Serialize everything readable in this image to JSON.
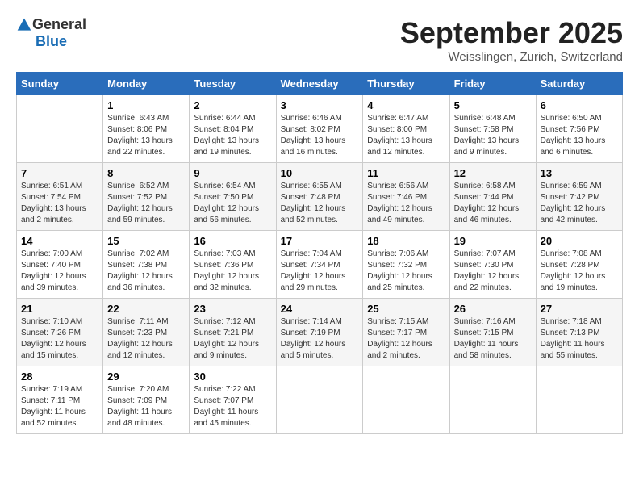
{
  "header": {
    "logo_general": "General",
    "logo_blue": "Blue",
    "month": "September 2025",
    "location": "Weisslingen, Zurich, Switzerland"
  },
  "days_of_week": [
    "Sunday",
    "Monday",
    "Tuesday",
    "Wednesday",
    "Thursday",
    "Friday",
    "Saturday"
  ],
  "weeks": [
    [
      {
        "day": "",
        "sunrise": "",
        "sunset": "",
        "daylight": ""
      },
      {
        "day": "1",
        "sunrise": "Sunrise: 6:43 AM",
        "sunset": "Sunset: 8:06 PM",
        "daylight": "Daylight: 13 hours and 22 minutes."
      },
      {
        "day": "2",
        "sunrise": "Sunrise: 6:44 AM",
        "sunset": "Sunset: 8:04 PM",
        "daylight": "Daylight: 13 hours and 19 minutes."
      },
      {
        "day": "3",
        "sunrise": "Sunrise: 6:46 AM",
        "sunset": "Sunset: 8:02 PM",
        "daylight": "Daylight: 13 hours and 16 minutes."
      },
      {
        "day": "4",
        "sunrise": "Sunrise: 6:47 AM",
        "sunset": "Sunset: 8:00 PM",
        "daylight": "Daylight: 13 hours and 12 minutes."
      },
      {
        "day": "5",
        "sunrise": "Sunrise: 6:48 AM",
        "sunset": "Sunset: 7:58 PM",
        "daylight": "Daylight: 13 hours and 9 minutes."
      },
      {
        "day": "6",
        "sunrise": "Sunrise: 6:50 AM",
        "sunset": "Sunset: 7:56 PM",
        "daylight": "Daylight: 13 hours and 6 minutes."
      }
    ],
    [
      {
        "day": "7",
        "sunrise": "Sunrise: 6:51 AM",
        "sunset": "Sunset: 7:54 PM",
        "daylight": "Daylight: 13 hours and 2 minutes."
      },
      {
        "day": "8",
        "sunrise": "Sunrise: 6:52 AM",
        "sunset": "Sunset: 7:52 PM",
        "daylight": "Daylight: 12 hours and 59 minutes."
      },
      {
        "day": "9",
        "sunrise": "Sunrise: 6:54 AM",
        "sunset": "Sunset: 7:50 PM",
        "daylight": "Daylight: 12 hours and 56 minutes."
      },
      {
        "day": "10",
        "sunrise": "Sunrise: 6:55 AM",
        "sunset": "Sunset: 7:48 PM",
        "daylight": "Daylight: 12 hours and 52 minutes."
      },
      {
        "day": "11",
        "sunrise": "Sunrise: 6:56 AM",
        "sunset": "Sunset: 7:46 PM",
        "daylight": "Daylight: 12 hours and 49 minutes."
      },
      {
        "day": "12",
        "sunrise": "Sunrise: 6:58 AM",
        "sunset": "Sunset: 7:44 PM",
        "daylight": "Daylight: 12 hours and 46 minutes."
      },
      {
        "day": "13",
        "sunrise": "Sunrise: 6:59 AM",
        "sunset": "Sunset: 7:42 PM",
        "daylight": "Daylight: 12 hours and 42 minutes."
      }
    ],
    [
      {
        "day": "14",
        "sunrise": "Sunrise: 7:00 AM",
        "sunset": "Sunset: 7:40 PM",
        "daylight": "Daylight: 12 hours and 39 minutes."
      },
      {
        "day": "15",
        "sunrise": "Sunrise: 7:02 AM",
        "sunset": "Sunset: 7:38 PM",
        "daylight": "Daylight: 12 hours and 36 minutes."
      },
      {
        "day": "16",
        "sunrise": "Sunrise: 7:03 AM",
        "sunset": "Sunset: 7:36 PM",
        "daylight": "Daylight: 12 hours and 32 minutes."
      },
      {
        "day": "17",
        "sunrise": "Sunrise: 7:04 AM",
        "sunset": "Sunset: 7:34 PM",
        "daylight": "Daylight: 12 hours and 29 minutes."
      },
      {
        "day": "18",
        "sunrise": "Sunrise: 7:06 AM",
        "sunset": "Sunset: 7:32 PM",
        "daylight": "Daylight: 12 hours and 25 minutes."
      },
      {
        "day": "19",
        "sunrise": "Sunrise: 7:07 AM",
        "sunset": "Sunset: 7:30 PM",
        "daylight": "Daylight: 12 hours and 22 minutes."
      },
      {
        "day": "20",
        "sunrise": "Sunrise: 7:08 AM",
        "sunset": "Sunset: 7:28 PM",
        "daylight": "Daylight: 12 hours and 19 minutes."
      }
    ],
    [
      {
        "day": "21",
        "sunrise": "Sunrise: 7:10 AM",
        "sunset": "Sunset: 7:26 PM",
        "daylight": "Daylight: 12 hours and 15 minutes."
      },
      {
        "day": "22",
        "sunrise": "Sunrise: 7:11 AM",
        "sunset": "Sunset: 7:23 PM",
        "daylight": "Daylight: 12 hours and 12 minutes."
      },
      {
        "day": "23",
        "sunrise": "Sunrise: 7:12 AM",
        "sunset": "Sunset: 7:21 PM",
        "daylight": "Daylight: 12 hours and 9 minutes."
      },
      {
        "day": "24",
        "sunrise": "Sunrise: 7:14 AM",
        "sunset": "Sunset: 7:19 PM",
        "daylight": "Daylight: 12 hours and 5 minutes."
      },
      {
        "day": "25",
        "sunrise": "Sunrise: 7:15 AM",
        "sunset": "Sunset: 7:17 PM",
        "daylight": "Daylight: 12 hours and 2 minutes."
      },
      {
        "day": "26",
        "sunrise": "Sunrise: 7:16 AM",
        "sunset": "Sunset: 7:15 PM",
        "daylight": "Daylight: 11 hours and 58 minutes."
      },
      {
        "day": "27",
        "sunrise": "Sunrise: 7:18 AM",
        "sunset": "Sunset: 7:13 PM",
        "daylight": "Daylight: 11 hours and 55 minutes."
      }
    ],
    [
      {
        "day": "28",
        "sunrise": "Sunrise: 7:19 AM",
        "sunset": "Sunset: 7:11 PM",
        "daylight": "Daylight: 11 hours and 52 minutes."
      },
      {
        "day": "29",
        "sunrise": "Sunrise: 7:20 AM",
        "sunset": "Sunset: 7:09 PM",
        "daylight": "Daylight: 11 hours and 48 minutes."
      },
      {
        "day": "30",
        "sunrise": "Sunrise: 7:22 AM",
        "sunset": "Sunset: 7:07 PM",
        "daylight": "Daylight: 11 hours and 45 minutes."
      },
      {
        "day": "",
        "sunrise": "",
        "sunset": "",
        "daylight": ""
      },
      {
        "day": "",
        "sunrise": "",
        "sunset": "",
        "daylight": ""
      },
      {
        "day": "",
        "sunrise": "",
        "sunset": "",
        "daylight": ""
      },
      {
        "day": "",
        "sunrise": "",
        "sunset": "",
        "daylight": ""
      }
    ]
  ]
}
